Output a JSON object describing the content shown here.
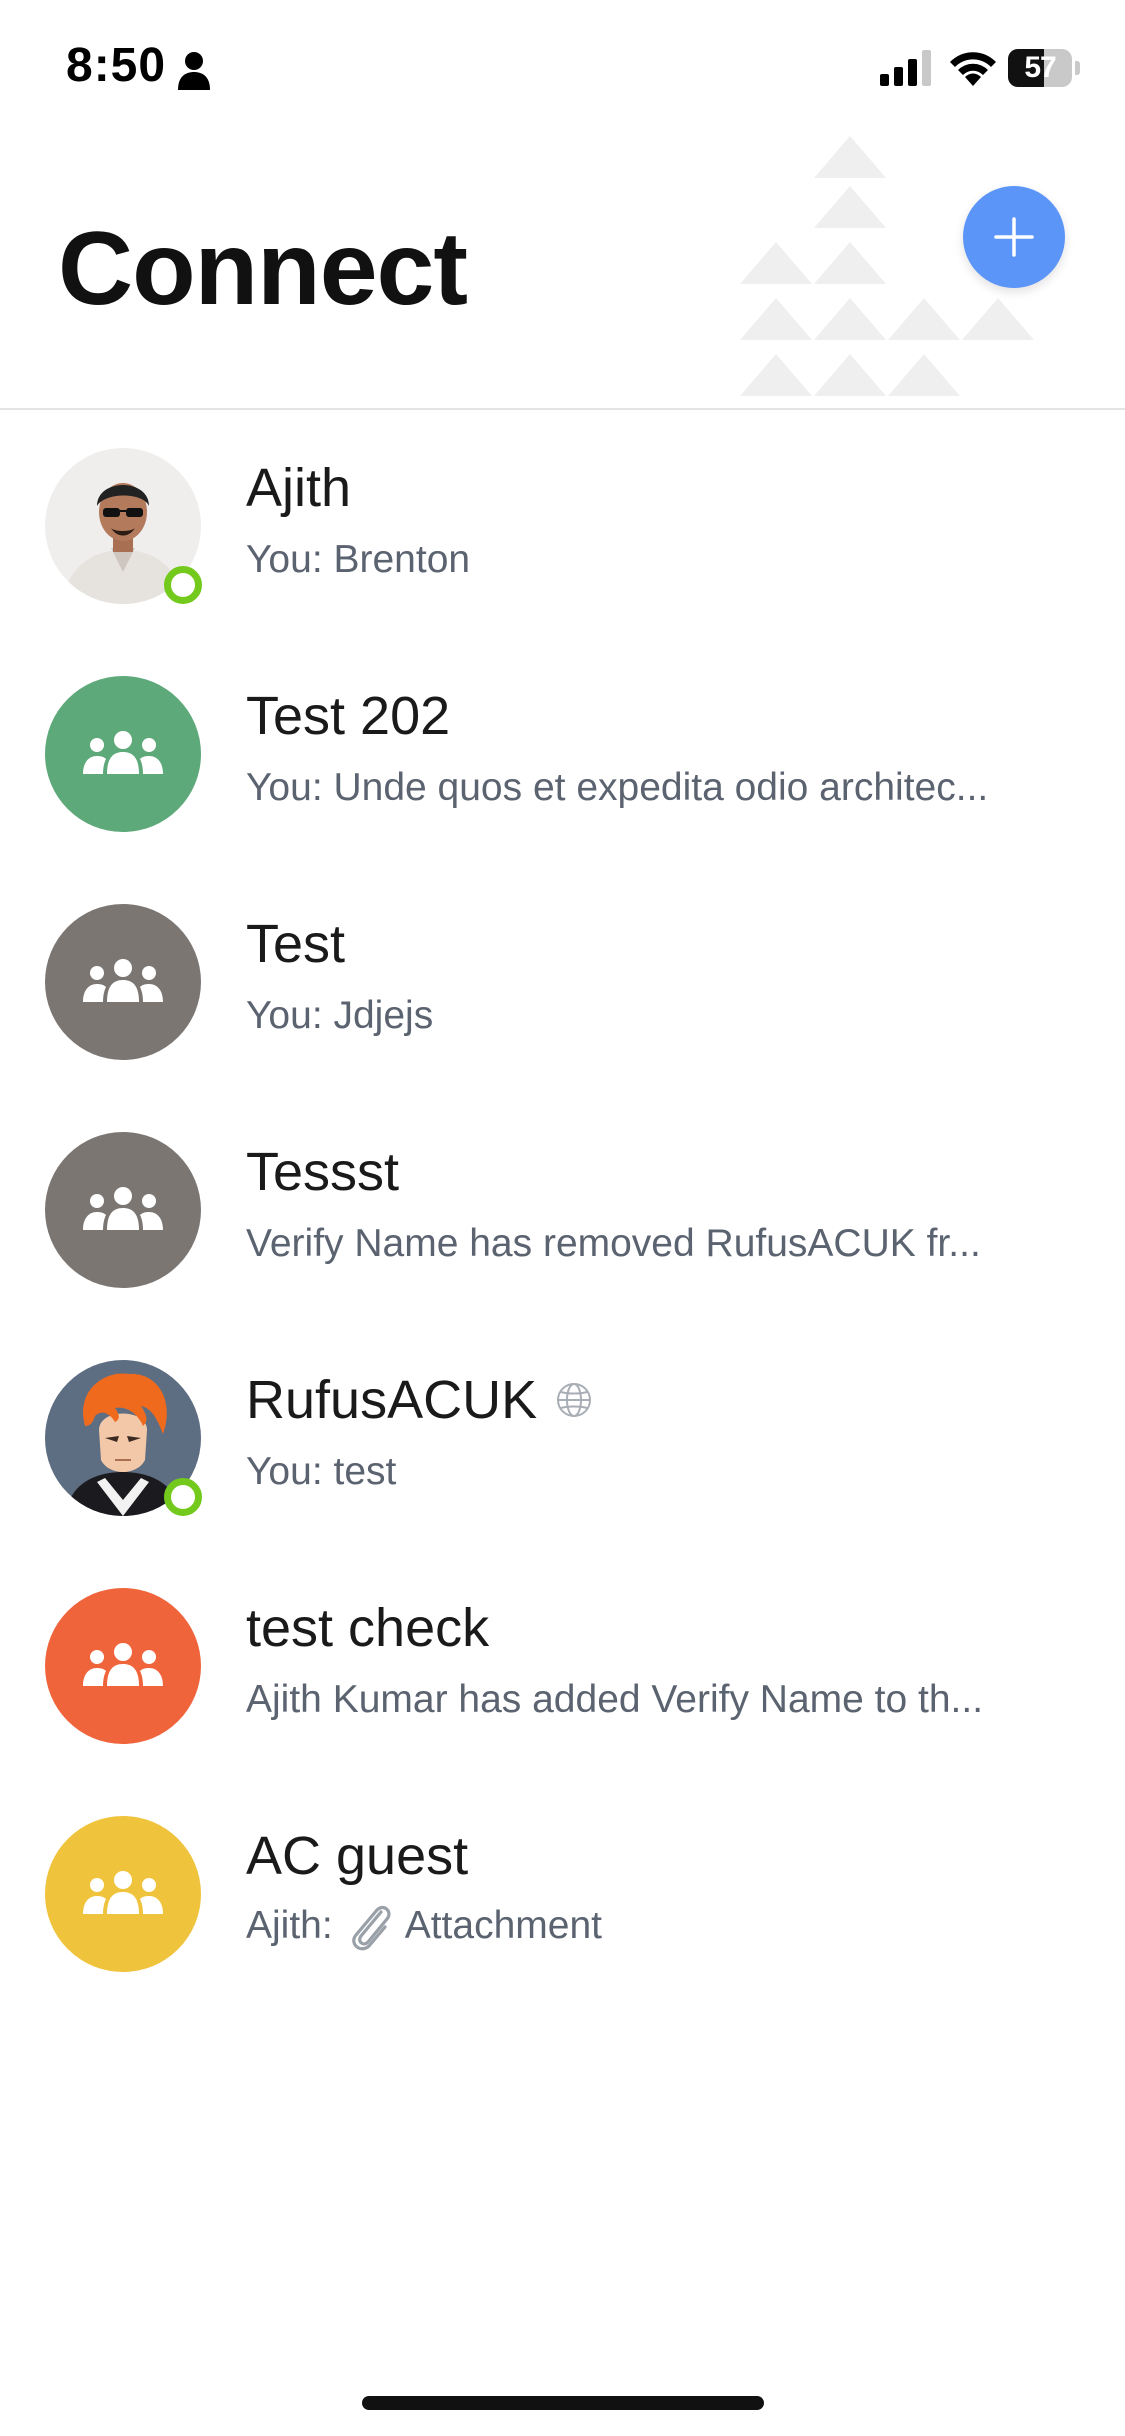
{
  "status_bar": {
    "time": "8:50",
    "battery_level": "57",
    "battery_fraction": 0.57
  },
  "header": {
    "title": "Connect",
    "add_button_icon": "plus-icon"
  },
  "colors": {
    "accent_blue": "#5b95f8",
    "online_green": "#73c91c",
    "group_green": "#5ea97a",
    "group_gray": "#7c7673",
    "group_orange": "#f0643c",
    "group_yellow": "#f0c33c"
  },
  "conversations": [
    {
      "name": "Ajith",
      "preview": "You: Brenton",
      "avatar": "photo",
      "online": true
    },
    {
      "name": "Test 202",
      "preview": "You: Unde quos et expedita odio architec...",
      "avatar": "group-icon"
    },
    {
      "name": "Test",
      "preview": "You: Jdjejs",
      "avatar": "group-icon"
    },
    {
      "name": "Tessst",
      "preview": "Verify Name has removed RufusACUK fr...",
      "avatar": "group-icon"
    },
    {
      "name": "RufusACUK",
      "preview": "You: test",
      "avatar": "photo",
      "online": true,
      "badge_icon": "globe-icon"
    },
    {
      "name": "test check",
      "preview": "Ajith Kumar has added Verify Name to th...",
      "avatar": "group-icon"
    },
    {
      "name": "AC guest",
      "preview_sender": "Ajith:",
      "preview": "Attachment",
      "avatar": "group-icon",
      "preview_icon": "paperclip-icon"
    }
  ]
}
